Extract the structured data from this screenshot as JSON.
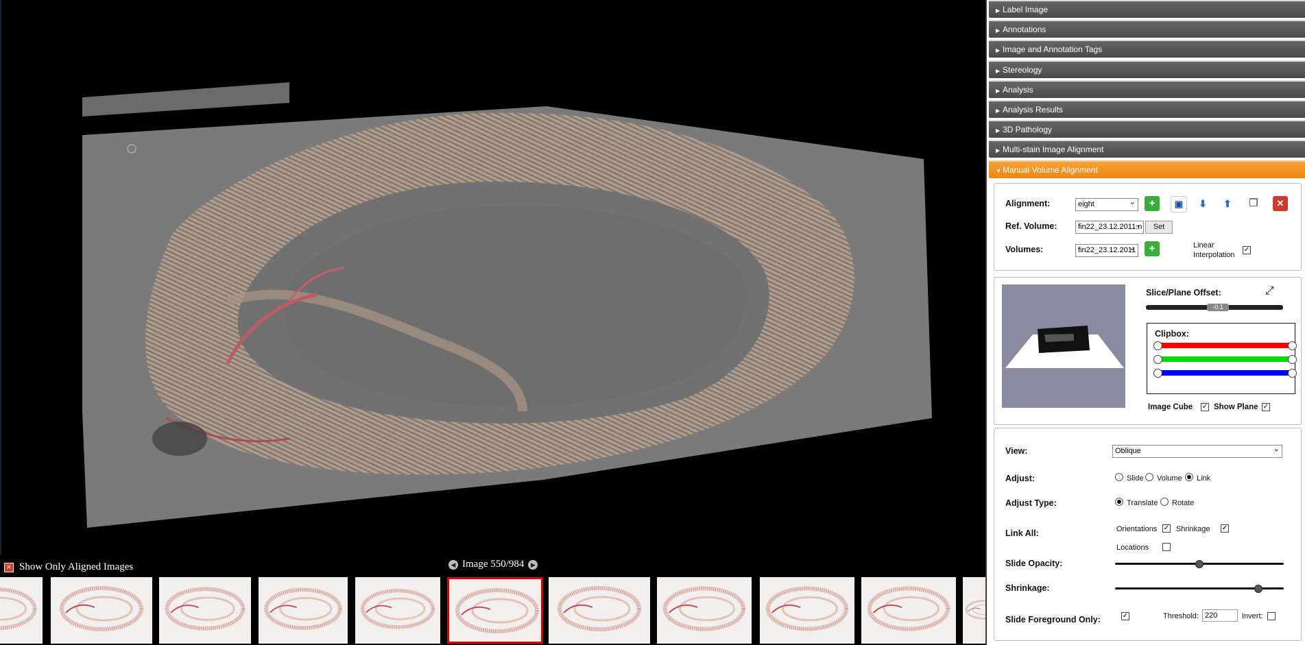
{
  "viewer": {
    "aligned_toggle_label": "Show Only Aligned Images",
    "image_counter": "Image 550/984",
    "selected_thumbnail_index": 5
  },
  "panel": {
    "sections": [
      {
        "label": "Label Image",
        "open": false
      },
      {
        "label": "Annotations",
        "open": false
      },
      {
        "label": "Image and Annotation Tags",
        "open": false
      },
      {
        "label": "Stereology",
        "open": false
      },
      {
        "label": "Analysis",
        "open": false
      },
      {
        "label": "Analysis Results",
        "open": false
      },
      {
        "label": "3D Pathology",
        "open": false
      },
      {
        "label": "Multi-stain Image Alignment",
        "open": false
      },
      {
        "label": "Manual Volume Alignment",
        "open": true
      }
    ],
    "alignment": {
      "alignment_label": "Alignment:",
      "alignment_value": "eight",
      "ref_volume_label": "Ref. Volume:",
      "ref_volume_value": "fin22_23.12.2011.n",
      "set_label": "Set",
      "volumes_label": "Volumes:",
      "volumes_value": "fin22_23.12.2011",
      "linear_label_1": "Linear",
      "linear_label_2": "Interpolation",
      "linear_checked": true
    },
    "slice": {
      "offset_label": "Slice/Plane Offset:",
      "offset_value": "-0.1",
      "clipbox_label": "Clipbox:",
      "clip_colors": [
        "#ff0000",
        "#00e000",
        "#0000ff"
      ],
      "image_cube_label": "Image Cube",
      "image_cube_checked": true,
      "show_plane_label": "Show Plane",
      "show_plane_checked": true
    },
    "view": {
      "view_label": "View:",
      "view_value": "Oblique",
      "adjust_label": "Adjust:",
      "adjust_options": [
        "Slide",
        "Volume",
        "Link"
      ],
      "adjust_selected": "Link",
      "adjust_type_label": "Adjust Type:",
      "adjust_type_options": [
        "Translate",
        "Rotate"
      ],
      "adjust_type_selected": "Translate",
      "link_all_label": "Link All:",
      "orientations_label": "Orientations",
      "orientations_checked": true,
      "shrinkage_check_label": "Shrinkage",
      "shrinkage_checked": true,
      "locations_label": "Locations",
      "locations_checked": false,
      "slide_opacity_label": "Slide Opacity:",
      "slide_opacity_level": 0.5,
      "shrinkage_label": "Shrinkage:",
      "shrinkage_level": 0.85,
      "fg_only_label": "Slide Foreground Only:",
      "fg_only_checked": true,
      "threshold_label": "Threshold:",
      "threshold_value": "220",
      "invert_label": "Invert:",
      "invert_checked": false
    }
  }
}
